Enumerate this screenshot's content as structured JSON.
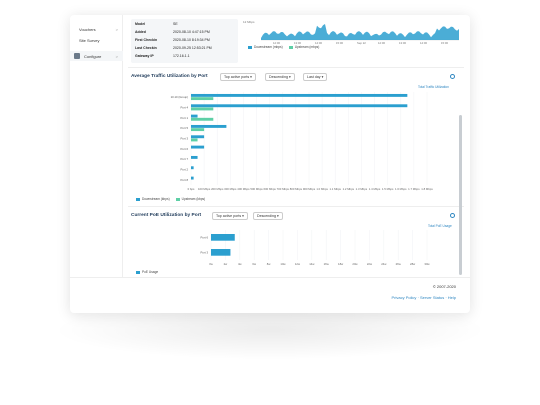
{
  "sidebar": {
    "items": [
      {
        "label": "Vouchers",
        "caret": ">"
      },
      {
        "label": "Site Survey",
        "caret": ""
      },
      {
        "label": "Configure",
        "caret": ">"
      }
    ]
  },
  "device_info": [
    {
      "key": "Model",
      "value": "SE"
    },
    {
      "key": "Added",
      "value": "2020-08-10 4:47:15 PM"
    },
    {
      "key": "First Checkin",
      "value": "2020-08-10 8:19:34 PM"
    },
    {
      "key": "Last Checkin",
      "value": "2020-09-25 12:53:21 PM"
    },
    {
      "key": "Gateway IP",
      "value": "172.16.1.1"
    }
  ],
  "top_chart": {
    "y_label": "12 Mbps",
    "x_ticks": [
      "12:00",
      "13:00",
      "14:00",
      "15:00",
      "Sep 22",
      "12:00",
      "13:00",
      "14:00",
      "15:00"
    ],
    "legend": [
      {
        "label": "Downstream (mbps)",
        "color": "#2b9fcf"
      },
      {
        "label": "Upstream (mbps)",
        "color": "#5ecfa6"
      }
    ]
  },
  "traffic": {
    "title": "Average Traffic Utilization by Port",
    "filter_ports": "Top active ports",
    "filter_order": "Descending",
    "filter_range": "Last day",
    "link": "Total Traffic Utilization",
    "legend": [
      {
        "label": "Downstream (kbps)",
        "color": "#2b9fcf"
      },
      {
        "label": "Upstream (kbps)",
        "color": "#5ecfa6"
      }
    ]
  },
  "poe": {
    "title": "Current PoE Utilization by Port",
    "filter_ports": "Top active ports",
    "filter_order": "Descending",
    "link": "Total PoE Usage",
    "legend": [
      {
        "label": "PoE Usage",
        "color": "#2b9fcf"
      }
    ]
  },
  "chart_data": [
    {
      "type": "bar",
      "title": "Average Traffic Utilization by Port",
      "categories": [
        "10.10 (Group)",
        "Port 4",
        "Port 1",
        "Port 5",
        "Port 3",
        "Port 6",
        "Port 7",
        "Port 2",
        "Port 8"
      ],
      "series": [
        {
          "name": "Downstream (kbps)",
          "values": [
            1.65,
            1.65,
            0.05,
            0.27,
            0.1,
            0.1,
            0.05,
            0.02,
            0.02
          ]
        },
        {
          "name": "Upstream (kbps)",
          "values": [
            0.17,
            0.17,
            0.17,
            0.1,
            0.05,
            0.0,
            0.0,
            0.0,
            0.0
          ]
        }
      ],
      "x_ticks": [
        "0 bps",
        "100 Mbps",
        "200 Mbps",
        "300 Mbps",
        "400 Mbps",
        "500 Mbps",
        "600 Mbps",
        "700 Mbps",
        "800 Mbps",
        "900 Mbps",
        "1.0 Mbps",
        "1.1 Mbps",
        "1.2 Mbps",
        "1.3 Mbps",
        "1.4 Mbps",
        "1.5 Mbps",
        "1.6 Mbps",
        "1.7 Mbps",
        "1.8 Mbps"
      ],
      "xlim": [
        0,
        1.8
      ]
    },
    {
      "type": "bar",
      "title": "Current PoE Utilization by Port",
      "categories": [
        "Port 6",
        "Port 3"
      ],
      "series": [
        {
          "name": "PoE Usage",
          "values": [
            3.3,
            2.7
          ]
        }
      ],
      "x_ticks": [
        "0w",
        "2w",
        "4w",
        "6w",
        "8w",
        "10w",
        "12w",
        "14w",
        "16w",
        "18w",
        "20w",
        "22w",
        "24w",
        "26w",
        "28w",
        "30w"
      ],
      "xlim": [
        0,
        30
      ]
    }
  ],
  "footer": {
    "copyright": "© 2007-2020",
    "links": "Privacy Policy · Server Status · Help"
  }
}
